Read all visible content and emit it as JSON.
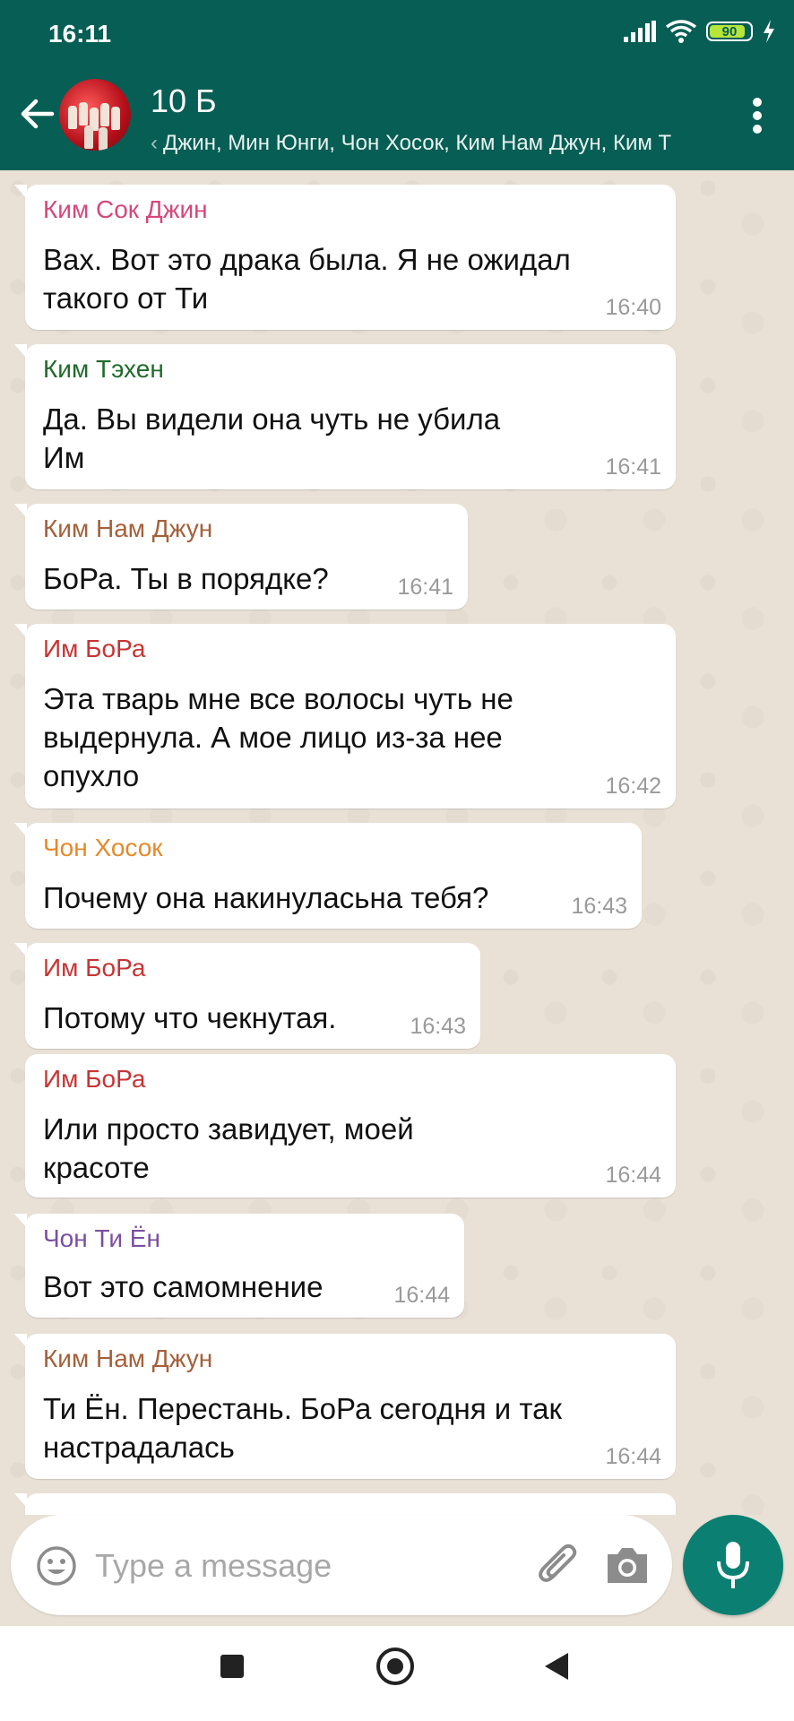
{
  "status_bar": {
    "time": "16:11",
    "battery": "90",
    "battery_level": 0.9
  },
  "header": {
    "title": "10 Б",
    "subtitle": "Джин, Мин Юнги, Чон Хосок, Ким Нам Джун, Ким Т",
    "back_icon": "arrow-left-icon",
    "menu_icon": "more-vertical-icon"
  },
  "messages": [
    {
      "sender": "Ким Сок Джин",
      "sender_color": "#d6477b",
      "text": "Вах. Вот это драка была. Я не ожидал\nтакого от Ти",
      "time": "16:40"
    },
    {
      "sender": "Ким Тэхен",
      "sender_color": "#1f6b2a",
      "text": "Да. Вы видели она чуть не убила\nИм",
      "time": "16:41"
    },
    {
      "sender": "Ким Нам Джун",
      "sender_color": "#a5603a",
      "text": "БоРа. Ты в порядке?",
      "time": "16:41"
    },
    {
      "sender": "Им БоРа",
      "sender_color": "#c83434",
      "text": "Эта тварь мне все волосы чуть не\nвыдернула. А мое лицо из-за нее\nопухло",
      "time": "16:42"
    },
    {
      "sender": "Чон Хосок",
      "sender_color": "#e5892a",
      "text": "Почему она накинуласьна тебя?",
      "time": "16:43"
    },
    {
      "sender": "Им БоРа",
      "sender_color": "#c83434",
      "text": "Потому что чекнутая.",
      "time": "16:43"
    },
    {
      "sender": "Им БоРа",
      "sender_color": "#c83434",
      "text": "Или просто завидует, моей\nкрасоте",
      "time": "16:44"
    },
    {
      "sender": "Чон Ти Ён",
      "sender_color": "#7a4fa0",
      "text": "Вот это самомнение",
      "time": "16:44"
    },
    {
      "sender": "Ким Нам Джун",
      "sender_color": "#a5603a",
      "text": "Ти Ён. Перестань. БоРа сегодня и так\nнастрадалась",
      "time": "16:44"
    }
  ],
  "composer": {
    "placeholder": "Type a message",
    "emoji_icon": "emoji-icon",
    "attach_icon": "paperclip-icon",
    "camera_icon": "camera-icon",
    "mic_icon": "mic-icon"
  },
  "colors": {
    "header_bg": "#075e54",
    "chat_bg": "#e9e1d6",
    "mic_bg": "#0b7f72"
  }
}
